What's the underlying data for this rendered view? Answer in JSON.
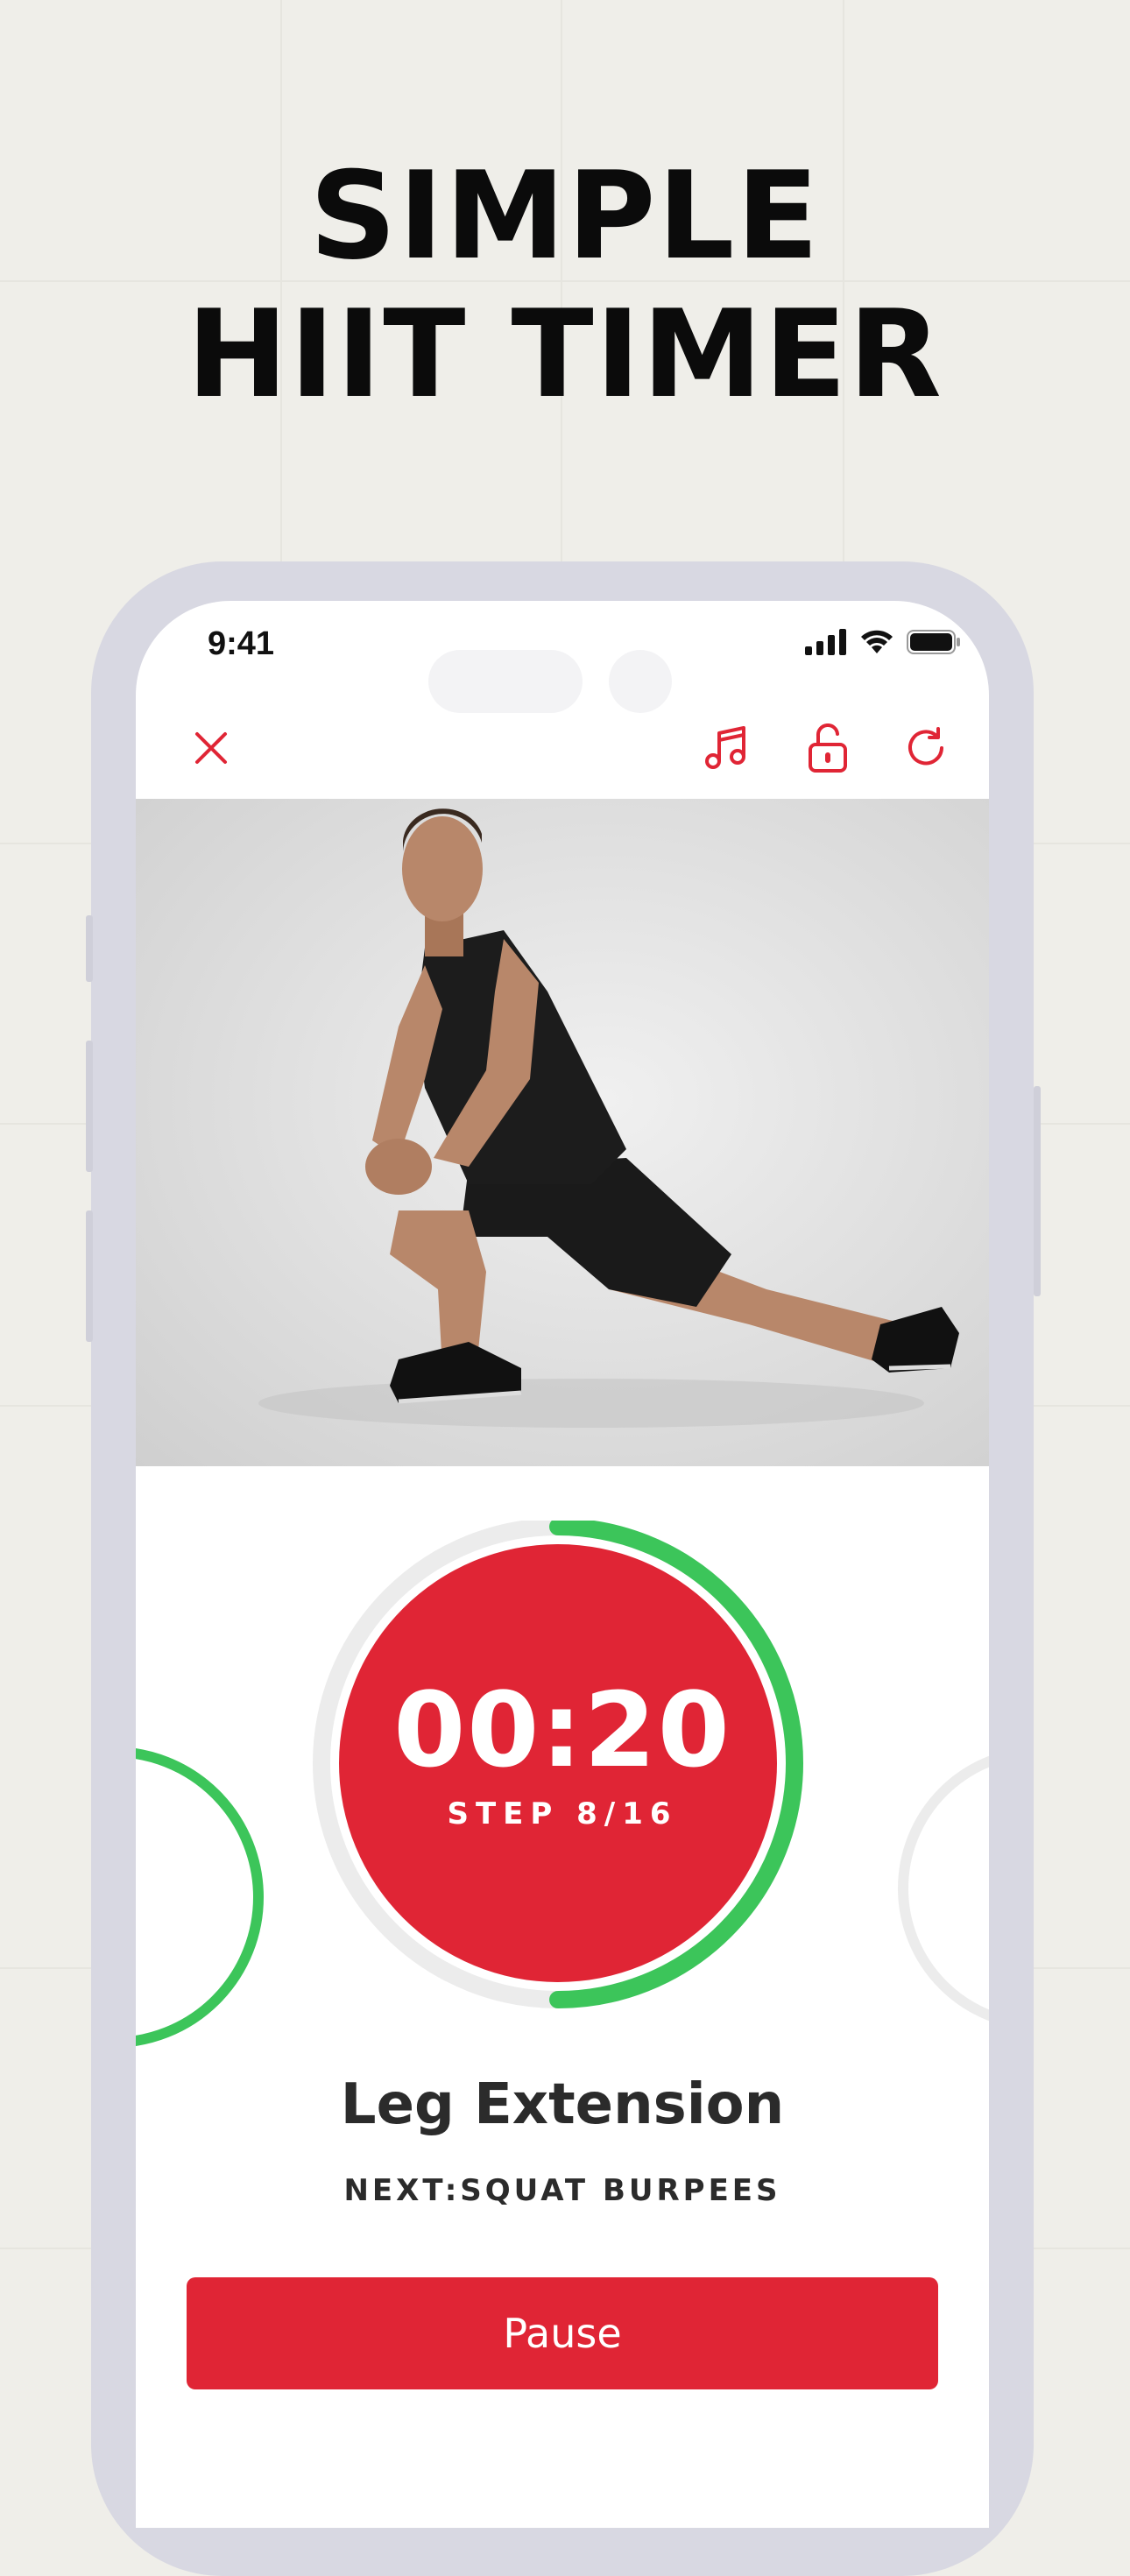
{
  "headline": {
    "line1": "SIMPLE",
    "line2": "HIIT TIMER"
  },
  "status_bar": {
    "time": "9:41",
    "icons": [
      "cellular-signal-icon",
      "wifi-icon",
      "battery-icon"
    ]
  },
  "toolbar": {
    "icons": [
      "close-icon",
      "music-note-icon",
      "unlock-icon",
      "refresh-icon"
    ]
  },
  "timer": {
    "time": "00:20",
    "step": "STEP 8/16",
    "progress": 0.5
  },
  "exercise": {
    "name": "Leg Extension",
    "next": "NEXT:SQUAT BURPEES"
  },
  "actions": {
    "pause_label": "Pause"
  },
  "colors": {
    "accent_red": "#e02535",
    "progress_green": "#3cc55a",
    "track_gray": "#ececec",
    "frame": "#d8d8e2",
    "background": "#efeee9"
  }
}
